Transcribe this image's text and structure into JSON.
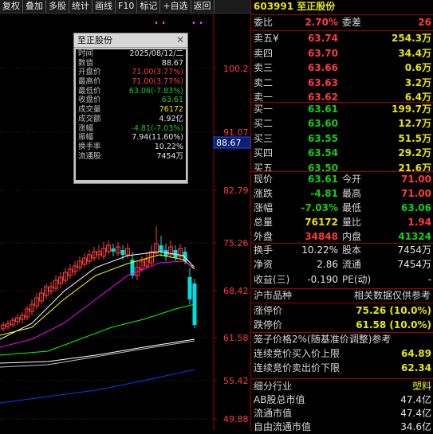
{
  "toolbar": {
    "items": [
      "复权",
      "叠加",
      "多股",
      "统计",
      "画线",
      "F10",
      "标记",
      "+自选",
      "返回"
    ]
  },
  "chart": {
    "price_labels": [
      "100.2",
      "91.07",
      "82.79",
      "75.26",
      "68.42",
      "61.58",
      "55.42",
      "49.88"
    ],
    "current_price_label": "88.67",
    "dots": "• •",
    "chart_data": {
      "type": "candlestick",
      "ma_colors": [
        "#ffffff",
        "#ffff00",
        "#ff00ff",
        "#00ff00",
        "#ffffff",
        "#0040ff"
      ]
    }
  },
  "infowin": {
    "title": "至正股份",
    "rows": [
      {
        "k": "时间",
        "v": "2025/08/12/二",
        "c": "wht"
      },
      {
        "k": "数值",
        "v": "88.67",
        "c": "wht"
      },
      {
        "k": "开盘价",
        "v": "71.00(3.77%)",
        "c": "red"
      },
      {
        "k": "最高价",
        "v": "71.00(3.77%)",
        "c": "red"
      },
      {
        "k": "最低价",
        "v": "63.06(-7.83%)",
        "c": "grn"
      },
      {
        "k": "收盘价",
        "v": "63.61",
        "c": "grn"
      },
      {
        "k": "成交量",
        "v": "76172",
        "c": "yel"
      },
      {
        "k": "成交额",
        "v": "4.92亿",
        "c": "wht"
      },
      {
        "k": "涨幅",
        "v": "-4.81(-7.03%)",
        "c": "grn"
      },
      {
        "k": "振幅",
        "v": "7.94(11.60%)",
        "c": "wht"
      },
      {
        "k": "换手率",
        "v": "10.22%",
        "c": "wht"
      },
      {
        "k": "流通股",
        "v": "7454万",
        "c": "wht"
      }
    ]
  },
  "panel": {
    "code": "603991",
    "name": "至正股份",
    "weibi_label": "委比",
    "weibi": "2.70%",
    "weicha_label": "委差",
    "weicha": "26",
    "asks": [
      {
        "label": "卖五",
        "price": "63.74",
        "vol": "254.3万"
      },
      {
        "label": "卖四",
        "price": "63.70",
        "vol": "34.4万"
      },
      {
        "label": "卖三",
        "price": "63.66",
        "vol": "0.6万"
      },
      {
        "label": "卖二",
        "price": "63.63",
        "vol": "3.2万"
      },
      {
        "label": "卖一",
        "price": "63.62",
        "vol": "6.4万"
      }
    ],
    "ask_marker": "¥",
    "bids": [
      {
        "label": "买一",
        "price": "63.61",
        "vol": "199.7万"
      },
      {
        "label": "买二",
        "price": "63.60",
        "vol": "12.7万"
      },
      {
        "label": "买三",
        "price": "63.55",
        "vol": "51.5万"
      },
      {
        "label": "买四",
        "price": "63.54",
        "vol": "29.2万"
      },
      {
        "label": "买五",
        "price": "63.50",
        "vol": "21.6万"
      }
    ],
    "quote": [
      {
        "l1": "现价",
        "v1": "63.61",
        "c1": "grn",
        "l2": "今开",
        "v2": "71.00",
        "c2": "red"
      },
      {
        "l1": "涨跌",
        "v1": "-4.81",
        "c1": "grn",
        "l2": "最高",
        "v2": "71.00",
        "c2": "red"
      },
      {
        "l1": "涨幅",
        "v1": "-7.03%",
        "c1": "grn",
        "l2": "最低",
        "v2": "63.06",
        "c2": "grn"
      },
      {
        "l1": "总量",
        "v1": "76172",
        "c1": "yel",
        "l2": "量比",
        "v2": "1.94",
        "c2": "red"
      },
      {
        "l1": "外盘",
        "v1": "34848",
        "c1": "red",
        "l2": "内盘",
        "v2": "41324",
        "c2": "grn"
      }
    ],
    "stats": [
      {
        "l1": "换手",
        "v1": "10.22%",
        "l2": "股本",
        "v2": "7454万"
      },
      {
        "l1": "净资",
        "v1": "2.86",
        "l2": "流通",
        "v2": "7454万"
      },
      {
        "l1": "收益(三)",
        "v1": "-0.190",
        "l2": "PE(动)",
        "v2": "-"
      }
    ],
    "huchuang": "沪市品种",
    "ref_note": "相关数据仅供参考",
    "limit_up_label": "涨停价",
    "limit_up": "75.26 (10.0%)",
    "limit_down_label": "跌停价",
    "limit_down": "61.58 (10.0%)",
    "cage": "笼子价格2%(随基准价调整)参考",
    "buy_limit_label": "连续竞价买入价上限",
    "buy_limit": "64.89",
    "sell_limit_label": "连续竞价卖出价下限",
    "sell_limit": "62.34",
    "industry_label": "细分行业",
    "industry": "塑料",
    "ab_label": "AB股总市值",
    "ab": "47.4亿",
    "float_label": "流通市值",
    "float": "47.4亿",
    "free_label": "自由流通市值",
    "free": "34.6亿"
  }
}
